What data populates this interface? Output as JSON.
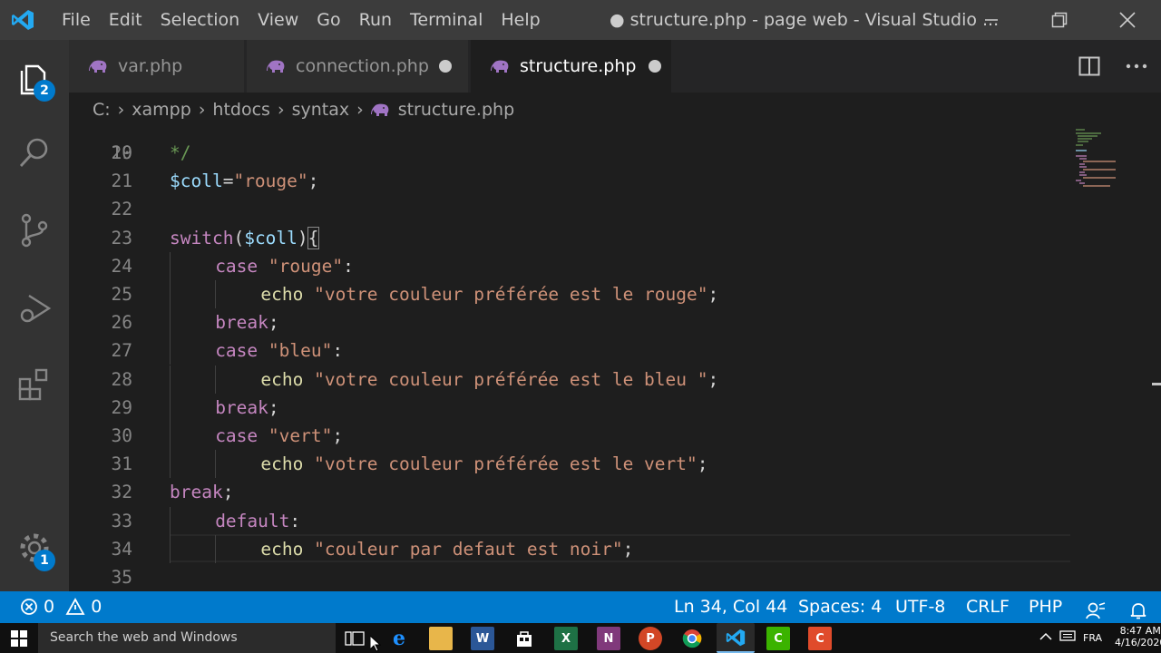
{
  "titlebar": {
    "menu": [
      "File",
      "Edit",
      "Selection",
      "View",
      "Go",
      "Run",
      "Terminal",
      "Help"
    ],
    "window_title": "● structure.php - page web - Visual Studio ..."
  },
  "activity": {
    "explorer_badge": "2",
    "settings_badge": "1"
  },
  "tabs": [
    {
      "label": "var.php",
      "dirty": false
    },
    {
      "label": "connection.php",
      "dirty": true
    },
    {
      "label": "structure.php",
      "dirty": true,
      "active": true
    }
  ],
  "breadcrumb": [
    "C:",
    "xampp",
    "htdocs",
    "syntax",
    "structure.php"
  ],
  "editor": {
    "partial_line_number": "19",
    "lines": [
      {
        "n": "20",
        "tokens": [
          {
            "t": "*/",
            "c": "com"
          }
        ]
      },
      {
        "n": "21",
        "tokens": [
          {
            "t": "$coll",
            "c": "var"
          },
          {
            "t": "=",
            "c": "plain"
          },
          {
            "t": "\"rouge\"",
            "c": "str"
          },
          {
            "t": ";",
            "c": "plain"
          }
        ]
      },
      {
        "n": "22",
        "tokens": []
      },
      {
        "n": "23",
        "tokens": [
          {
            "t": "switch",
            "c": "ctl"
          },
          {
            "t": "(",
            "c": "plain"
          },
          {
            "t": "$coll",
            "c": "var"
          },
          {
            "t": ")",
            "c": "plain"
          },
          {
            "t": "{",
            "c": "plain"
          }
        ]
      },
      {
        "n": "24",
        "indent": 1,
        "tokens": [
          {
            "t": "case",
            "c": "ctl"
          },
          {
            "t": " ",
            "c": "plain"
          },
          {
            "t": "\"rouge\"",
            "c": "str"
          },
          {
            "t": ":",
            "c": "plain"
          }
        ]
      },
      {
        "n": "25",
        "indent": 2,
        "tokens": [
          {
            "t": "echo",
            "c": "fn"
          },
          {
            "t": " ",
            "c": "plain"
          },
          {
            "t": "\"votre couleur préférée est le rouge\"",
            "c": "str"
          },
          {
            "t": ";",
            "c": "plain"
          }
        ]
      },
      {
        "n": "26",
        "indent": 1,
        "tokens": [
          {
            "t": "break",
            "c": "ctl"
          },
          {
            "t": ";",
            "c": "plain"
          }
        ]
      },
      {
        "n": "27",
        "indent": 1,
        "tokens": [
          {
            "t": "case",
            "c": "ctl"
          },
          {
            "t": " ",
            "c": "plain"
          },
          {
            "t": "\"bleu\"",
            "c": "str"
          },
          {
            "t": ":",
            "c": "plain"
          }
        ]
      },
      {
        "n": "28",
        "indent": 2,
        "tokens": [
          {
            "t": "echo",
            "c": "fn"
          },
          {
            "t": " ",
            "c": "plain"
          },
          {
            "t": "\"votre couleur préférée est le bleu \"",
            "c": "str"
          },
          {
            "t": ";",
            "c": "plain"
          }
        ]
      },
      {
        "n": "29",
        "indent": 1,
        "tokens": [
          {
            "t": "break",
            "c": "ctl"
          },
          {
            "t": ";",
            "c": "plain"
          }
        ]
      },
      {
        "n": "30",
        "indent": 1,
        "tokens": [
          {
            "t": "case",
            "c": "ctl"
          },
          {
            "t": " ",
            "c": "plain"
          },
          {
            "t": "\"vert\"",
            "c": "str"
          },
          {
            "t": ";",
            "c": "plain"
          }
        ]
      },
      {
        "n": "31",
        "indent": 2,
        "tokens": [
          {
            "t": "echo",
            "c": "fn"
          },
          {
            "t": " ",
            "c": "plain"
          },
          {
            "t": "\"votre couleur préférée est le vert\"",
            "c": "str"
          },
          {
            "t": ";",
            "c": "plain"
          }
        ]
      },
      {
        "n": "32",
        "tokens": [
          {
            "t": "break",
            "c": "ctl"
          },
          {
            "t": ";",
            "c": "plain"
          }
        ]
      },
      {
        "n": "33",
        "indent": 1,
        "tokens": [
          {
            "t": "default",
            "c": "ctl"
          },
          {
            "t": ":",
            "c": "plain"
          }
        ]
      },
      {
        "n": "34",
        "indent": 2,
        "tokens": [
          {
            "t": "echo",
            "c": "fn"
          },
          {
            "t": " ",
            "c": "plain"
          },
          {
            "t": "\"couleur par defaut est noir\"",
            "c": "str"
          },
          {
            "t": ";",
            "c": "plain"
          }
        ]
      },
      {
        "n": "35",
        "tokens": []
      }
    ]
  },
  "statusbar": {
    "errors": "0",
    "warnings": "0",
    "position": "Ln 34, Col 44",
    "spaces": "Spaces: 4",
    "encoding": "UTF-8",
    "eol": "CRLF",
    "language": "PHP"
  },
  "taskbar": {
    "search_placeholder": "Search the web and Windows",
    "language": "FRA",
    "time": "8:47 AM",
    "date": "4/16/2020"
  },
  "colors": {
    "accent": "#007acc",
    "keyword": "#c586c0",
    "variable": "#9cdcfe",
    "string": "#ce9178",
    "comment": "#6a9955"
  }
}
